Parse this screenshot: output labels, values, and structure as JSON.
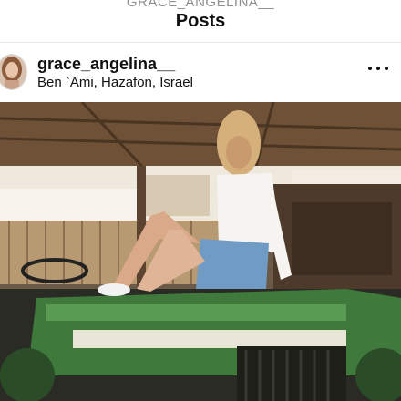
{
  "header": {
    "account_name": "GRACE_ANGELINA__",
    "title": "Posts"
  },
  "post": {
    "username": "grace_angelina__",
    "location": "Ben `Ami, Hazafon, Israel",
    "more_icon": "more-horizontal-icon",
    "image_alt": "Woman sitting on a green tractor in a barn"
  },
  "colors": {
    "tractor_green": "#3f7a3c",
    "barn_wood": "#7a5e40"
  }
}
